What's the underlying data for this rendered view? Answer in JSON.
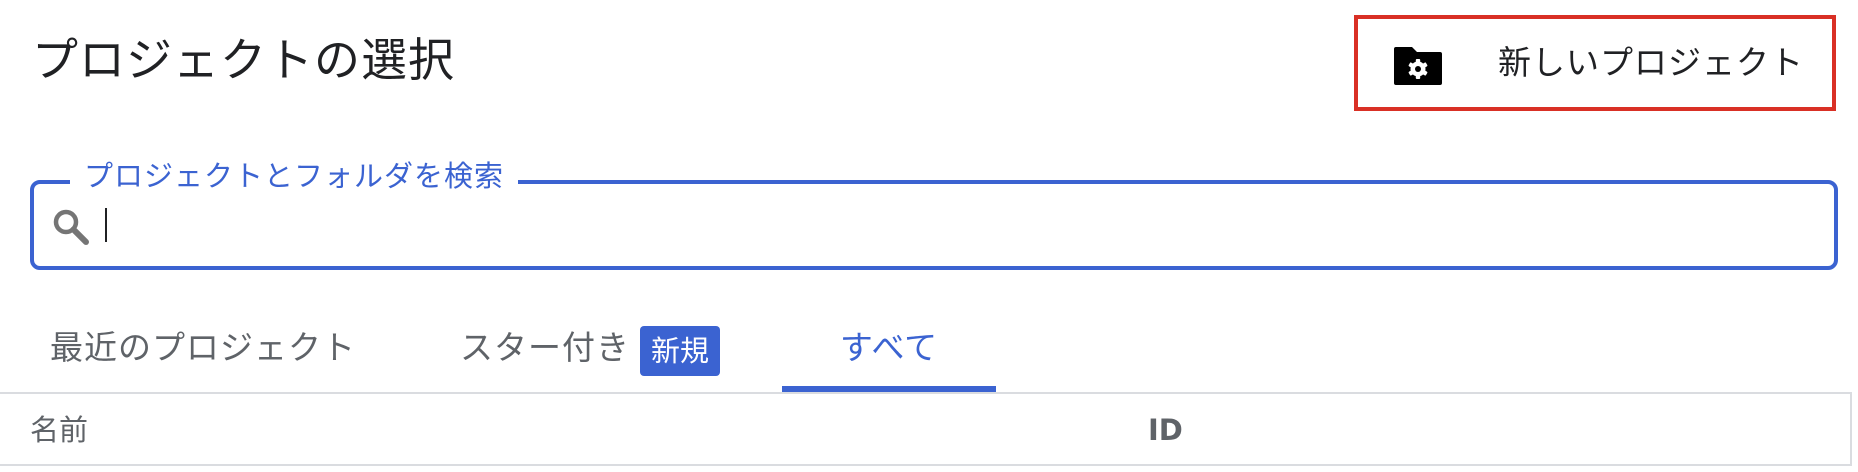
{
  "dialog": {
    "title": "プロジェクトの選択"
  },
  "new_project_button": {
    "label": "新しいプロジェクト",
    "icon": "folder-settings-icon"
  },
  "search": {
    "legend": "プロジェクトとフォルダを検索",
    "value": "",
    "icon": "search-icon"
  },
  "tabs": [
    {
      "label": "最近のプロジェクト",
      "active": false
    },
    {
      "label": "スター付き",
      "badge": "新規",
      "active": false
    },
    {
      "label": "すべて",
      "active": true
    }
  ],
  "table": {
    "columns": [
      "名前",
      "ID"
    ]
  },
  "colors": {
    "accent": "#3b63d1",
    "highlight_border": "#d93025",
    "text_primary": "#202124",
    "text_secondary": "#5f6368",
    "divider": "#dadce0"
  }
}
